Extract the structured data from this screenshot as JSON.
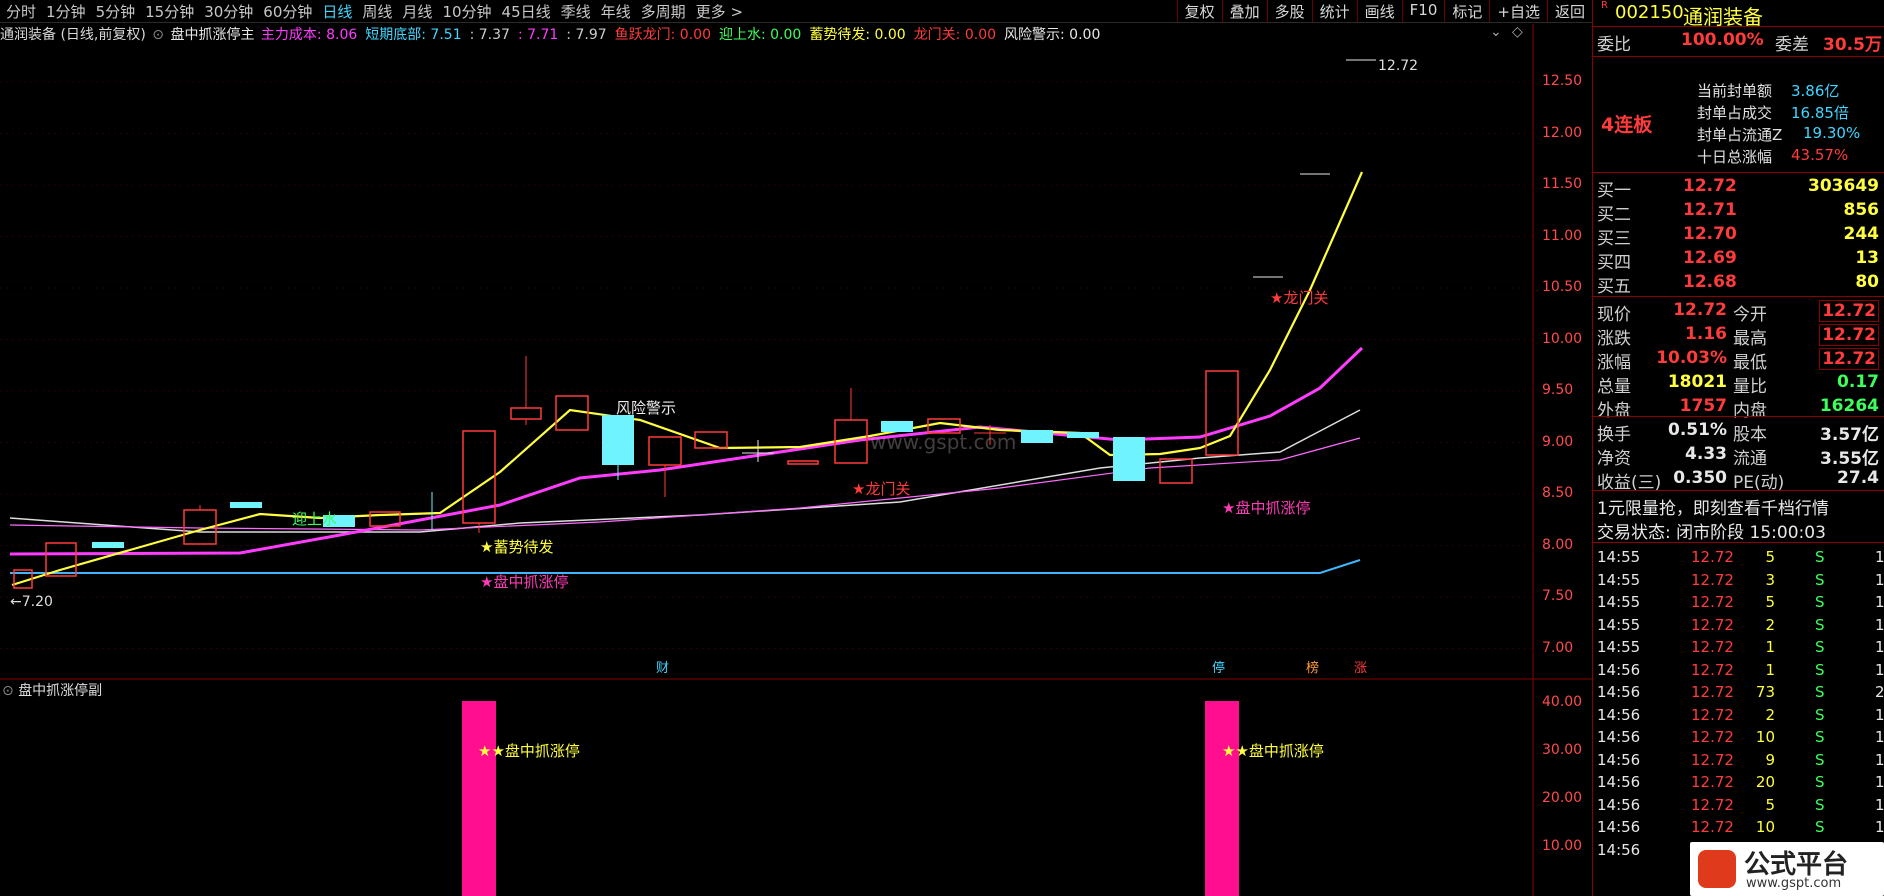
{
  "toolbar": {
    "periods": [
      "分时",
      "1分钟",
      "5分钟",
      "15分钟",
      "30分钟",
      "60分钟",
      "日线",
      "周线",
      "月线",
      "10分钟",
      "45日线",
      "季线",
      "年线",
      "多周期",
      "更多 >"
    ],
    "active_period": "日线",
    "buttons": [
      "复权",
      "叠加",
      "多股",
      "统计",
      "画线",
      "F10",
      "标记",
      "+自选",
      "返回"
    ]
  },
  "indicator": {
    "stock_label": "通润装备 (日线,前复权)",
    "name": "盘中抓涨停主",
    "items": [
      {
        "label": "主力成本:",
        "value": "8.06",
        "color": "#ff3cff"
      },
      {
        "label": "短期底部:",
        "value": "7.51",
        "color": "#3fd6ff"
      },
      {
        "label": ":",
        "value": "7.37",
        "color": "#cccccc"
      },
      {
        "label": ":",
        "value": "7.71",
        "color": "#ff3cff"
      },
      {
        "label": ":",
        "value": "7.97",
        "color": "#cccccc"
      },
      {
        "label": "鱼跃龙门:",
        "value": "0.00",
        "color": "#ff3b3b"
      },
      {
        "label": "迎上水:",
        "value": "0.00",
        "color": "#3cff5c"
      },
      {
        "label": "蓄势待发:",
        "value": "0.00",
        "color": "#ffff40"
      },
      {
        "label": "龙门关:",
        "value": "0.00",
        "color": "#ff3b3b"
      },
      {
        "label": "风险警示:",
        "value": "0.00",
        "color": "#e8e8e8"
      }
    ]
  },
  "chart": {
    "price_axis": [
      "12.50",
      "12.00",
      "11.50",
      "11.00",
      "10.50",
      "10.00",
      "9.50",
      "9.00",
      "8.50",
      "8.00",
      "7.50",
      "7.00"
    ],
    "high_label": "12.72",
    "low_label": "←7.20",
    "annotations": {
      "risk": "风险警示",
      "yingshangshui": "迎上水",
      "xushi": "★蓄势待发",
      "zhuazhangting1": "★盘中抓涨停",
      "zhuazhangting2": "★盘中抓涨停",
      "longmenguan1": "★龙门关",
      "longmenguan2": "★龙门关",
      "watermark": "www.gspt.com"
    },
    "event_tags": [
      {
        "text": "财",
        "color": "#3fd6ff"
      },
      {
        "text": "停",
        "color": "#3fd6ff"
      },
      {
        "text": "榜",
        "color": "#ff9a3c"
      },
      {
        "text": "涨",
        "color": "#ff3b3b"
      }
    ]
  },
  "sub_chart": {
    "label": "盘中抓涨停副",
    "axis": [
      "40.00",
      "30.00",
      "20.00",
      "10.00"
    ],
    "signal_text_1": "★★盘中抓涨停",
    "signal_text_2": "★★盘中抓涨停"
  },
  "panel": {
    "code": "002150",
    "name": "通润装备",
    "weibi_label": "委比",
    "weibi_value": "100.00%",
    "weicha_label": "委差",
    "weicha_value": "30.5万",
    "lianban": "4连板",
    "seal_info": [
      {
        "label": "当前封单额",
        "value": "3.86亿"
      },
      {
        "label": "封单占成交",
        "value": "16.85倍"
      },
      {
        "label": "封单占流通Z",
        "value": "19.30%"
      },
      {
        "label": "十日总涨幅",
        "value": "43.57%"
      }
    ],
    "bids": [
      {
        "label": "买一",
        "price": "12.72",
        "vol": "303649"
      },
      {
        "label": "买二",
        "price": "12.71",
        "vol": "856"
      },
      {
        "label": "买三",
        "price": "12.70",
        "vol": "244"
      },
      {
        "label": "买四",
        "price": "12.69",
        "vol": "13"
      },
      {
        "label": "买五",
        "price": "12.68",
        "vol": "80"
      }
    ],
    "stats": [
      {
        "l1": "现价",
        "v1": "12.72",
        "l2": "今开",
        "v2": "12.72"
      },
      {
        "l1": "涨跌",
        "v1": "1.16",
        "l2": "最高",
        "v2": "12.72"
      },
      {
        "l1": "涨幅",
        "v1": "10.03%",
        "l2": "最低",
        "v2": "12.72"
      },
      {
        "l1": "总量",
        "v1": "18021",
        "l2": "量比",
        "v2": "0.17"
      },
      {
        "l1": "外盘",
        "v1": "1757",
        "l2": "内盘",
        "v2": "16264"
      }
    ],
    "stats2": [
      {
        "l1": "换手",
        "v1": "0.51%",
        "l2": "股本",
        "v2": "3.57亿"
      },
      {
        "l1": "净资",
        "v1": "4.33",
        "l2": "流通",
        "v2": "3.55亿"
      },
      {
        "l1": "收益(三)",
        "v1": "0.350",
        "l2": "PE(动)",
        "v2": "27.4"
      }
    ],
    "promo": "1元限量抢，即刻查看千档行情",
    "trade_state": "交易状态: 闭市阶段 15:00:03",
    "ticks": [
      {
        "time": "14:55",
        "price": "12.72",
        "vol": "5",
        "bs": "S",
        "n": "1"
      },
      {
        "time": "14:55",
        "price": "12.72",
        "vol": "3",
        "bs": "S",
        "n": "1"
      },
      {
        "time": "14:55",
        "price": "12.72",
        "vol": "5",
        "bs": "S",
        "n": "1"
      },
      {
        "time": "14:55",
        "price": "12.72",
        "vol": "2",
        "bs": "S",
        "n": "1"
      },
      {
        "time": "14:55",
        "price": "12.72",
        "vol": "1",
        "bs": "S",
        "n": "1"
      },
      {
        "time": "14:56",
        "price": "12.72",
        "vol": "1",
        "bs": "S",
        "n": "1"
      },
      {
        "time": "14:56",
        "price": "12.72",
        "vol": "73",
        "bs": "S",
        "n": "2"
      },
      {
        "time": "14:56",
        "price": "12.72",
        "vol": "2",
        "bs": "S",
        "n": "1"
      },
      {
        "time": "14:56",
        "price": "12.72",
        "vol": "10",
        "bs": "S",
        "n": "1"
      },
      {
        "time": "14:56",
        "price": "12.72",
        "vol": "9",
        "bs": "S",
        "n": "1"
      },
      {
        "time": "14:56",
        "price": "12.72",
        "vol": "20",
        "bs": "S",
        "n": "1"
      },
      {
        "time": "14:56",
        "price": "12.72",
        "vol": "5",
        "bs": "S",
        "n": "1"
      },
      {
        "time": "14:56",
        "price": "12.72",
        "vol": "10",
        "bs": "S",
        "n": "1"
      },
      {
        "time": "14:56",
        "price": "12.72",
        "vol": "",
        "bs": "",
        "n": ""
      }
    ],
    "logo_text": "公式平台",
    "logo_url": "www.gspt.com"
  }
}
